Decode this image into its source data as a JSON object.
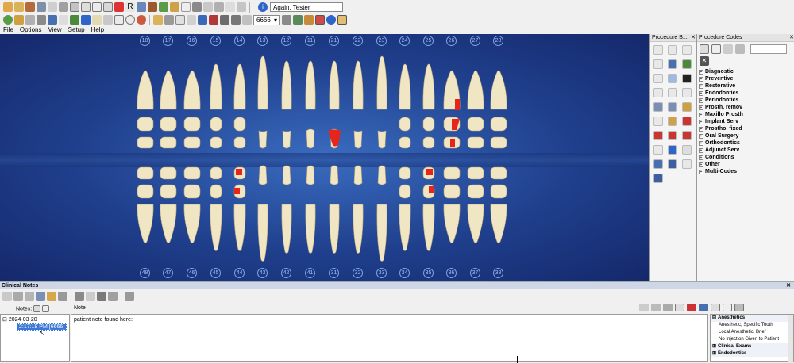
{
  "toolbar": {
    "patient_name": "Again, Tester",
    "provider_select": "6666"
  },
  "menu": [
    "File",
    "Options",
    "View",
    "Setup",
    "Help"
  ],
  "teeth": {
    "upper_numbers": [
      "18",
      "17",
      "16",
      "15",
      "14",
      "13",
      "12",
      "11",
      "21",
      "22",
      "23",
      "24",
      "25",
      "26",
      "27",
      "28"
    ],
    "lower_numbers": [
      "48",
      "47",
      "46",
      "45",
      "44",
      "43",
      "42",
      "41",
      "31",
      "32",
      "33",
      "34",
      "35",
      "36",
      "37",
      "38"
    ]
  },
  "procedure_buttons_panel": {
    "title": "Procedure B..."
  },
  "procedure_codes_panel": {
    "title": "Procedure Codes",
    "categories": [
      "Diagnostic",
      "Preventive",
      "Restorative",
      "Endodontics",
      "Periodontics",
      "Prosth, remov",
      "Maxillo Prosth",
      "Implant Serv",
      "Prostho, fixed",
      "Oral Surgery",
      "Orthodontics",
      "Adjunct Serv",
      "Conditions",
      "Other",
      "Multi-Codes"
    ]
  },
  "clinical_notes": {
    "title": "Clinical Notes",
    "notes_label": "Notes:",
    "note_label": "Note",
    "tree_date": "2024-03-20",
    "tree_entry": "2:17:18 PM [6666]",
    "note_text": "patient note found here:"
  },
  "quick_notes": {
    "groups": [
      {
        "label": "Anesthetics",
        "items": [
          "Anesthetic, Specific Tooth",
          "Local Anesthetic, Brief",
          "No Injection Given to Patient"
        ]
      },
      {
        "label": "Clinical Exams",
        "items": []
      },
      {
        "label": "Endodontics",
        "items": []
      }
    ]
  },
  "colors": {
    "chart_bg": "#1f3f8c",
    "tooth": "#f1e6c4",
    "caries": "#e8251b",
    "selection": "#3b78d8"
  }
}
